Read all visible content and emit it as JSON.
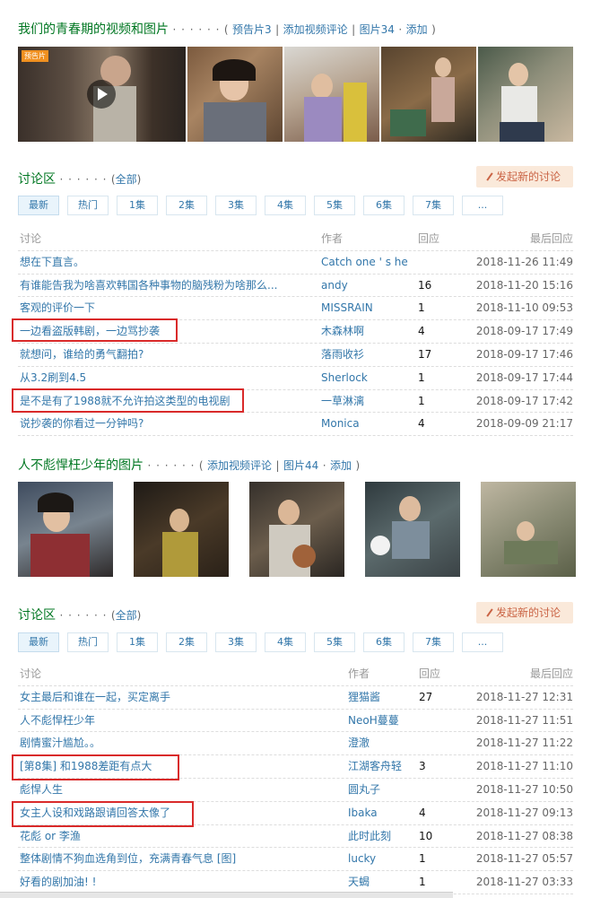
{
  "section1": {
    "title": "我们的青春期的视频和图片",
    "dots": "· · · · · ·",
    "open": "(",
    "link1": "预告片3",
    "link2": "添加视频评论",
    "link3": "图片34",
    "link4": "添加",
    "sep": "|",
    "dot": "·",
    "close": ")",
    "trailer_badge": "预告片"
  },
  "forum1": {
    "title": "讨论区",
    "dots": "· · · · · ·",
    "all_link": "全部",
    "new_topic": "发起新的讨论",
    "tabs": [
      "最新",
      "热门",
      "1集",
      "2集",
      "3集",
      "4集",
      "5集",
      "6集",
      "7集",
      "..."
    ],
    "headers": [
      "讨论",
      "作者",
      "回应",
      "最后回应"
    ],
    "rows": [
      {
        "title": "想在下直言。",
        "author": "Catch one ' s he",
        "replies": "",
        "last": "2018-11-26 11:49"
      },
      {
        "title": "有谁能告我为啥喜欢韩国各种事物的脑残粉为啥那么...",
        "author": "andy",
        "replies": "16",
        "last": "2018-11-20 15:16"
      },
      {
        "title": "客观的评价一下",
        "author": "MISSRAIN",
        "replies": "1",
        "last": "2018-11-10 09:53"
      },
      {
        "title": "一边看盗版韩剧，一边骂抄袭",
        "author": "木森林啊",
        "replies": "4",
        "last": "2018-09-17 17:49"
      },
      {
        "title": "就想问，谁给的勇气翻拍?",
        "author": "落雨收衫",
        "replies": "17",
        "last": "2018-09-17 17:46"
      },
      {
        "title": "从3.2刷到4.5",
        "author": "Sherlock",
        "replies": "1",
        "last": "2018-09-17 17:44"
      },
      {
        "title": "是不是有了1988就不允许拍这类型的电视剧",
        "author": "一草淋漓",
        "replies": "1",
        "last": "2018-09-17 17:42"
      },
      {
        "title": "说抄袭的你看过一分钟吗?",
        "author": "Monica",
        "replies": "4",
        "last": "2018-09-09 21:17"
      }
    ]
  },
  "section2": {
    "title": "人不彪悍枉少年的图片",
    "dots": "· · · · · ·",
    "open": "(",
    "link1": "添加视频评论",
    "link2": "图片44",
    "link3": "添加",
    "sep": "|",
    "dot": "·",
    "close": ")"
  },
  "forum2": {
    "title": "讨论区",
    "dots": "· · · · · ·",
    "all_link": "全部",
    "new_topic": "发起新的讨论",
    "tabs": [
      "最新",
      "热门",
      "1集",
      "2集",
      "3集",
      "4集",
      "5集",
      "6集",
      "7集",
      "..."
    ],
    "headers": [
      "讨论",
      "作者",
      "回应",
      "最后回应"
    ],
    "rows": [
      {
        "title": "女主最后和谁在一起，买定离手",
        "author": "狸猫酱",
        "replies": "27",
        "last": "2018-11-27 12:31"
      },
      {
        "title": "人不彪悍枉少年",
        "author": "NeoH蔓蔓",
        "replies": "",
        "last": "2018-11-27 11:51"
      },
      {
        "title": "剧情蜜汁尴尬。。",
        "author": "澄澈",
        "replies": "",
        "last": "2018-11-27 11:22"
      },
      {
        "title": "[第8集] 和1988差距有点大",
        "author": "江湖客舟轻",
        "replies": "3",
        "last": "2018-11-27 11:10"
      },
      {
        "title": "彪悍人生",
        "author": "圆丸子",
        "replies": "",
        "last": "2018-11-27 10:50"
      },
      {
        "title": "女主人设和戏路跟请回答太像了",
        "author": "Ibaka",
        "replies": "4",
        "last": "2018-11-27 09:13"
      },
      {
        "title": "花彪 or 李渔",
        "author": "此时此刻",
        "replies": "10",
        "last": "2018-11-27 08:38"
      },
      {
        "title": "整体剧情不狗血选角到位，充满青春气息 [图]",
        "author": "lucky",
        "replies": "1",
        "last": "2018-11-27 05:57"
      },
      {
        "title": "好看的剧加油! !",
        "author": "天蝎",
        "replies": "1",
        "last": "2018-11-27 03:33"
      }
    ]
  },
  "colors": {
    "green_title": "#007722",
    "link_blue": "#3377aa",
    "highlight_red": "#d92a2a",
    "new_btn_bg": "#fae9da"
  }
}
